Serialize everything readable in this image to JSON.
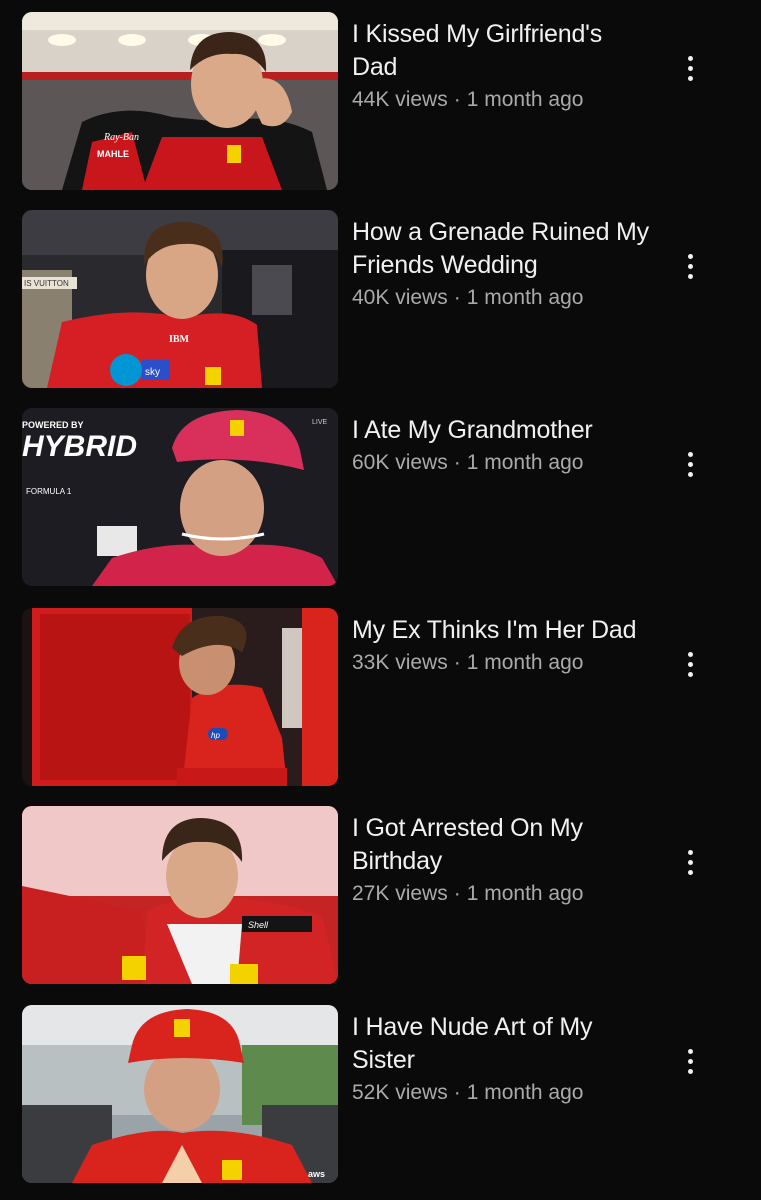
{
  "videos": [
    {
      "title": "I Kissed My Girlfriend's Dad",
      "views": "44K views",
      "age": "1 month ago",
      "thumb_text": [
        "Ray-Ban",
        "MAHLE"
      ]
    },
    {
      "title": "How a Grenade Ruined My Friends Wedding",
      "views": "40K views",
      "age": "1 month ago",
      "thumb_text": [
        "IS VUITTON",
        "IBM",
        "sky"
      ]
    },
    {
      "title": "I Ate My Grandmother",
      "views": "60K views",
      "age": "1 month ago",
      "thumb_text": [
        "POWERED BY",
        "HYBRID",
        "FORMULA 1",
        "LIVE"
      ]
    },
    {
      "title": "My Ex Thinks I'm Her Dad",
      "views": "33K views",
      "age": "1 month ago",
      "thumb_text": [
        "hp"
      ]
    },
    {
      "title": "I Got Arrested On My Birthday",
      "views": "27K views",
      "age": "1 month ago",
      "thumb_text": [
        "Shell"
      ]
    },
    {
      "title": "I Have Nude Art of My Sister",
      "views": "52K views",
      "age": "1 month ago",
      "thumb_text": [
        "aws"
      ]
    }
  ],
  "separator": "·",
  "icons": {
    "menu": "more-vert-icon"
  },
  "colors": {
    "background": "#0a0a0a",
    "title": "#f1f1f1",
    "meta": "#aaaaaa",
    "ferrari_red": "#d11f1c"
  }
}
